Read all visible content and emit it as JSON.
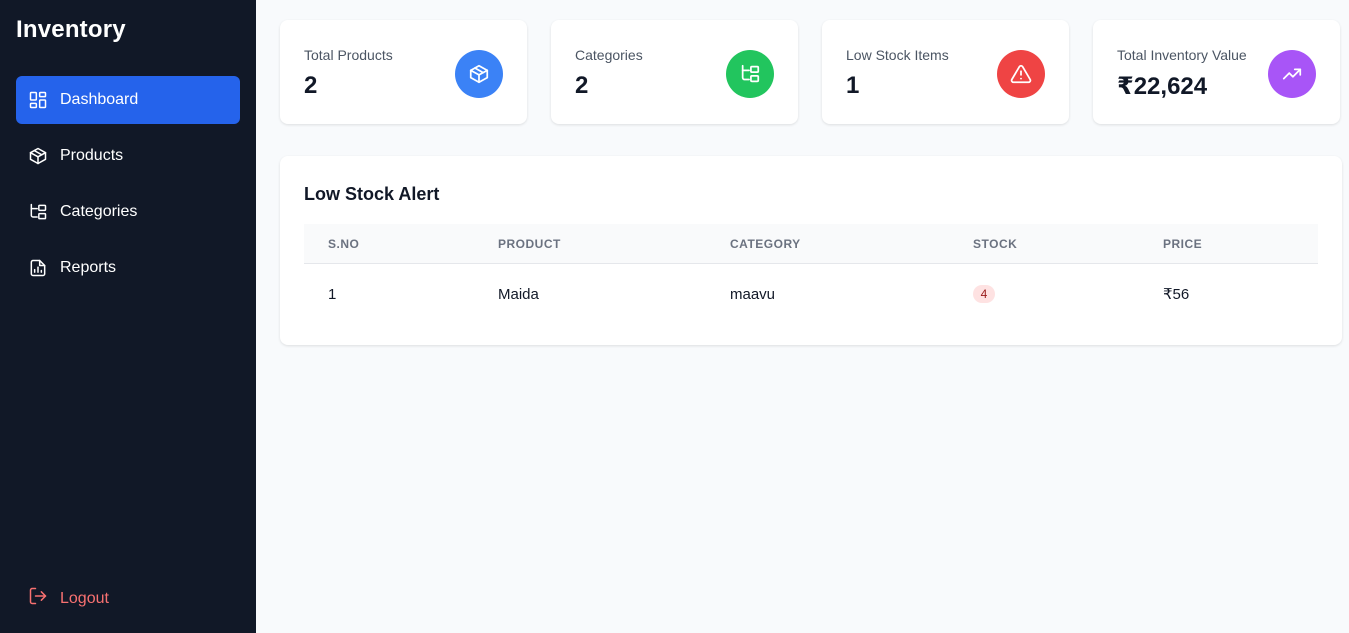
{
  "sidebar": {
    "brand": "Inventory",
    "items": [
      {
        "label": "Dashboard",
        "icon": "dashboard-icon",
        "active": true
      },
      {
        "label": "Products",
        "icon": "box-icon",
        "active": false
      },
      {
        "label": "Categories",
        "icon": "categories-icon",
        "active": false
      },
      {
        "label": "Reports",
        "icon": "report-icon",
        "active": false
      }
    ],
    "logout_label": "Logout"
  },
  "stats": [
    {
      "label": "Total Products",
      "value": "2",
      "icon": "box-icon",
      "color": "#3b82f6"
    },
    {
      "label": "Categories",
      "value": "2",
      "icon": "categories-icon",
      "color": "#22c55e"
    },
    {
      "label": "Low Stock Items",
      "value": "1",
      "icon": "alert-triangle-icon",
      "color": "#ef4444"
    },
    {
      "label": "Total Inventory Value",
      "value": "₹22,624",
      "icon": "trending-up-icon",
      "color": "#a855f7"
    }
  ],
  "low_stock": {
    "title": "Low Stock Alert",
    "columns": [
      "S.NO",
      "PRODUCT",
      "CATEGORY",
      "STOCK",
      "PRICE"
    ],
    "rows": [
      {
        "sno": "1",
        "product": "Maida",
        "category": "maavu",
        "stock": "4",
        "price": "₹56"
      }
    ]
  },
  "colors": {
    "sidebar_bg": "#111827",
    "accent": "#2563eb",
    "logout": "#f87171",
    "page_bg": "#f8fafc"
  }
}
